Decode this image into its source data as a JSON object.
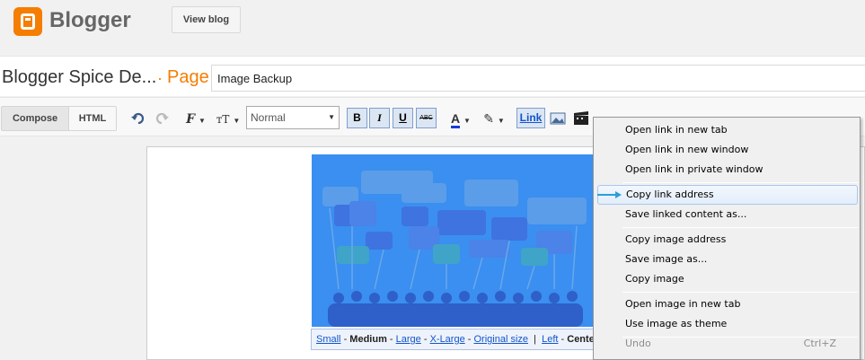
{
  "brand": {
    "name": "Blogger",
    "color": "#f57d00"
  },
  "header": {
    "view_blog_label": "View blog"
  },
  "post": {
    "blog_name": "Blogger Spice De...",
    "separator": "·",
    "type_label": "Page",
    "title_value": "Image Backup"
  },
  "toolbar": {
    "compose_label": "Compose",
    "html_label": "HTML",
    "font_size_value": "Normal",
    "bold_label": "B",
    "italic_label": "I",
    "underline_label": "U",
    "strike_label": "ABC",
    "link_label": "Link"
  },
  "image_sizes": {
    "small": "Small",
    "medium": "Medium",
    "large": "Large",
    "xlarge": "X-Large",
    "original": "Original size",
    "left": "Left",
    "center": "Cente"
  },
  "context_menu": {
    "items": [
      {
        "label": "Open link in new tab"
      },
      {
        "label": "Open link in new window"
      },
      {
        "label": "Open link in private window"
      },
      {
        "label": "Copy link address",
        "highlighted": true
      },
      {
        "label": "Save linked content as..."
      },
      {
        "label": "Copy image address"
      },
      {
        "label": "Save image as..."
      },
      {
        "label": "Copy image"
      },
      {
        "label": "Open image in new tab"
      },
      {
        "label": "Use image as theme"
      },
      {
        "label": "Undo",
        "shortcut": "Ctrl+Z",
        "disabled": true
      }
    ]
  },
  "icons": {
    "logo": "blogger-logo-icon",
    "undo": "undo-icon",
    "redo": "redo-icon",
    "font": "font-family-icon",
    "font_size": "font-size-icon",
    "text_color": "text-color-icon",
    "highlight": "highlight-icon",
    "image": "insert-image-icon",
    "video": "insert-video-icon",
    "pointer": "arrow-pointer-icon"
  },
  "colors": {
    "accent": "#f57d00",
    "link": "#1155cc",
    "menu_highlight": "#e3eefb",
    "image_bg": "#3a8ff0"
  }
}
